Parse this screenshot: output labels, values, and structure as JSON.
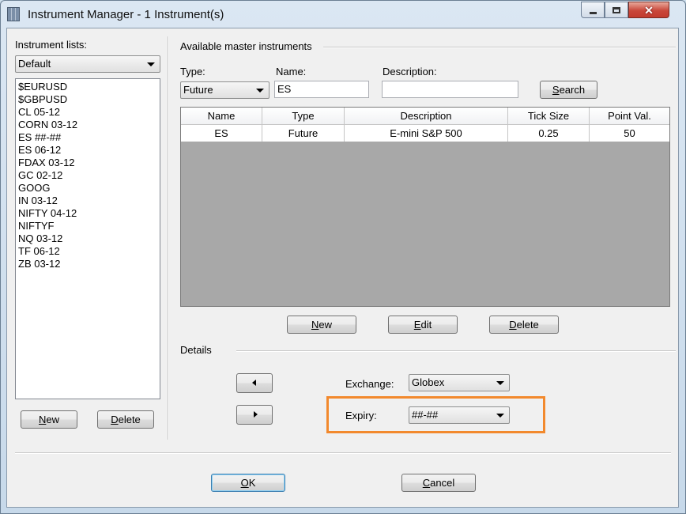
{
  "window": {
    "title": "Instrument Manager - 1 Instrument(s)",
    "icon": "instrument-manager-app-icon",
    "controls": {
      "minimize": "minimize-icon",
      "maximize": "maximize-icon",
      "close": "✕"
    }
  },
  "left_panel": {
    "lists_label": "Instrument lists:",
    "selected_list": "Default",
    "instruments": [
      "$EURUSD",
      "$GBPUSD",
      "CL 05-12",
      "CORN 03-12",
      "ES ##-##",
      "ES 06-12",
      "FDAX 03-12",
      "GC 02-12",
      "GOOG",
      "IN 03-12",
      "NIFTY 04-12",
      "NIFTYF",
      "NQ 03-12",
      "TF 06-12",
      "ZB 03-12"
    ],
    "new_button": "New",
    "delete_button": "Delete"
  },
  "master": {
    "group_label": "Available master instruments",
    "type_label": "Type:",
    "type_value": "Future",
    "name_label": "Name:",
    "name_value": "ES",
    "description_label": "Description:",
    "description_value": "",
    "search_button": "Search",
    "columns": [
      "Name",
      "Type",
      "Description",
      "Tick Size",
      "Point Val."
    ],
    "rows": [
      [
        "ES",
        "Future",
        "E-mini S&P 500",
        "0.25",
        "50"
      ]
    ],
    "new_button": "New",
    "edit_button": "Edit",
    "delete_button": "Delete"
  },
  "details": {
    "group_label": "Details",
    "exchange_label": "Exchange:",
    "exchange_value": "Globex",
    "expiry_label": "Expiry:",
    "expiry_value": "##-##",
    "highlight_color": "#f2892d"
  },
  "footer": {
    "ok_button": "OK",
    "cancel_button": "Cancel"
  }
}
